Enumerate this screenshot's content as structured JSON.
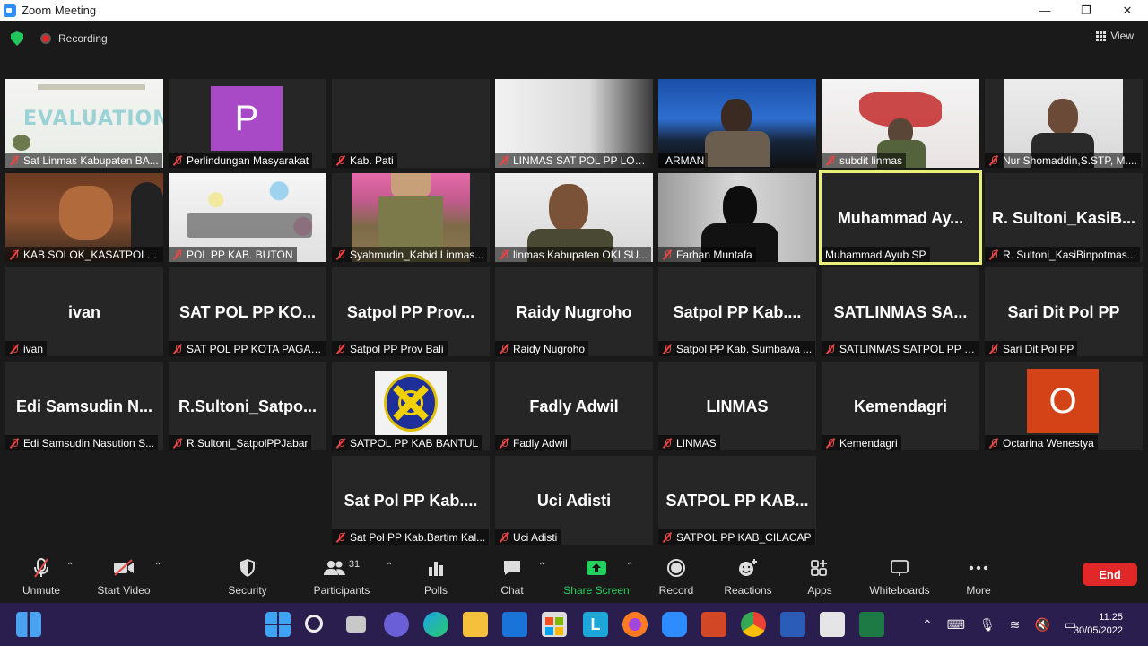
{
  "window": {
    "title": "Zoom Meeting",
    "minimize": "—",
    "maximize": "❐",
    "close": "✕"
  },
  "topbar": {
    "recording": "Recording",
    "view": "View"
  },
  "tiles": [
    {
      "name": "Sat Linmas Kabupaten BA..."
    },
    {
      "name": "Perlindungan Masyarakat",
      "avatar": "P"
    },
    {
      "name": "Kab. Pati"
    },
    {
      "name": "LINMAS SAT POL PP LOTIM"
    },
    {
      "name": "ARMAN"
    },
    {
      "name": "subdit linmas"
    },
    {
      "name": "Nur Shomaddin,S.STP, M...."
    },
    {
      "name": "KAB SOLOK_KASATPOL P..."
    },
    {
      "name": "POL PP KAB. BUTON"
    },
    {
      "name": "Syahmudin_Kabid Linmas..."
    },
    {
      "name": "linmas Kabupaten OKI SU..."
    },
    {
      "name": "Farhan Muntafa"
    },
    {
      "big": "Muhammad  Ay...",
      "name": "Muhammad Ayub SP"
    },
    {
      "big": "R. Sultoni_KasiB...",
      "name": "R. Sultoni_KasiBinpotmas..."
    },
    {
      "big": "ivan",
      "name": "ivan"
    },
    {
      "big": "SAT  POL  PP  KO...",
      "name": "SAT POL PP KOTA PAGAR ..."
    },
    {
      "big": "Satpol  PP  Prov...",
      "name": "Satpol PP Prov Bali"
    },
    {
      "big": "Raidy Nugroho",
      "name": "Raidy Nugroho"
    },
    {
      "big": "Satpol  PP  Kab....",
      "name": "Satpol PP Kab. Sumbawa ..."
    },
    {
      "big": "SATLINMAS  SA...",
      "name": "SATLINMAS SATPOL PP P..."
    },
    {
      "big": "Sari Dit Pol PP",
      "name": "Sari Dit Pol PP"
    },
    {
      "big": "Edi  Samsudin  N...",
      "name": "Edi Samsudin Nasution S..."
    },
    {
      "big": "R.Sultoni_Satpo...",
      "name": "R.Sultoni_SatpolPPJabar"
    },
    {
      "name": "SATPOL PP KAB BANTUL"
    },
    {
      "big": "Fadly Adwil",
      "name": "Fadly Adwil"
    },
    {
      "big": "LINMAS",
      "name": "LINMAS"
    },
    {
      "big": "Kemendagri",
      "name": "Kemendagri"
    },
    {
      "name": "Octarina Wenestya",
      "avatar": "O"
    },
    {
      "big": "Sat  Pol  PP  Kab....",
      "name": "Sat Pol PP Kab.Bartim Kal..."
    },
    {
      "big": "Uci Adisti",
      "name": "Uci Adisti"
    },
    {
      "big": "SATPOL  PP  KAB...",
      "name": "SATPOL PP KAB_CILACAP"
    }
  ],
  "toolbar": {
    "unmute": "Unmute",
    "start_video": "Start Video",
    "security": "Security",
    "participants": "Participants",
    "participants_count": "31",
    "polls": "Polls",
    "chat": "Chat",
    "share_screen": "Share Screen",
    "record": "Record",
    "reactions": "Reactions",
    "apps": "Apps",
    "whiteboards": "Whiteboards",
    "more": "More",
    "end": "End"
  },
  "taskbar": {
    "time": "11:25",
    "date": "30/05/2022"
  },
  "colors": {
    "muted_red": "#e54646",
    "share_green": "#23d160",
    "end_red": "#e02828",
    "active_border": "#e8ef7a"
  }
}
